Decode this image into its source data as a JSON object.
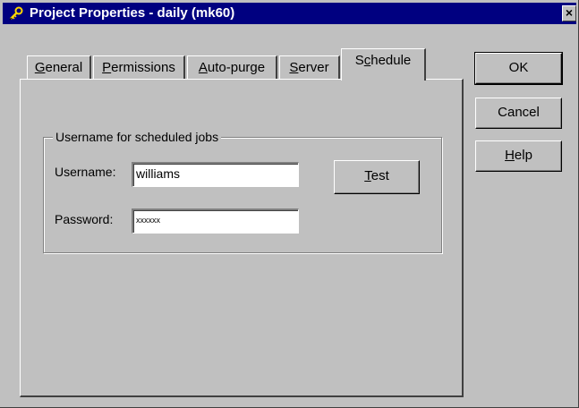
{
  "window": {
    "title": "Project Properties - daily (mk60)",
    "close_glyph": "×",
    "icon": "key-icon"
  },
  "tabs": [
    {
      "label": "General",
      "mnemonic": "G",
      "rest": "eneral",
      "active": false
    },
    {
      "label": "Permissions",
      "mnemonic": "P",
      "rest": "ermissions",
      "active": false
    },
    {
      "label": "Auto-purge",
      "mnemonic": "A",
      "rest": "uto-purge",
      "active": false
    },
    {
      "label": "Server",
      "mnemonic": "S",
      "rest": "erver",
      "active": false
    },
    {
      "label": "Schedule",
      "pre": "S",
      "mnemonic": "c",
      "rest": "hedule",
      "active": true
    }
  ],
  "schedule": {
    "group_label": "Username for scheduled jobs",
    "username_label": "Username:",
    "username_value": "williams",
    "password_label": "Password:",
    "password_value": "xxxxxx",
    "test_button": {
      "mnemonic": "T",
      "rest": "est"
    }
  },
  "buttons": {
    "ok": "OK",
    "cancel": "Cancel",
    "help": {
      "mnemonic": "H",
      "rest": "elp"
    }
  },
  "colors": {
    "titlebar": "#000080",
    "face": "#c0c0c0"
  }
}
